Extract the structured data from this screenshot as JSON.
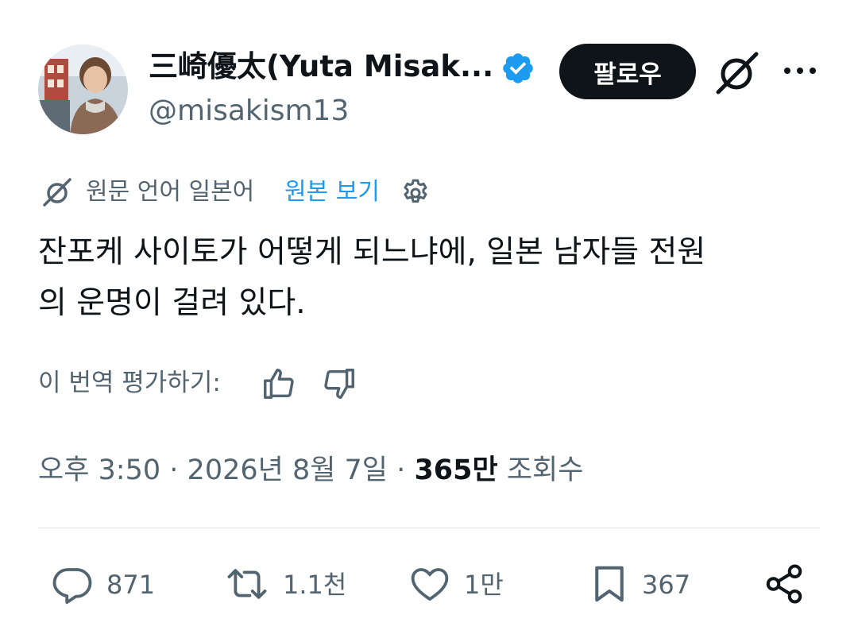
{
  "header": {
    "display_name": "三崎優太(Yuta Misak...",
    "handle": "@misakism13",
    "follow_label": "팔로우"
  },
  "translation": {
    "notice": "원문 언어 일본어",
    "view_original": "원본 보기"
  },
  "tweet": {
    "text_line1": "잔포케 사이토가 어떻게 되느냐에, 일본 남자들 전원",
    "text_line2": "의 운명이 걸려 있다."
  },
  "rate": {
    "label": "이 번역 평가하기:"
  },
  "meta": {
    "time": "오후 3:50",
    "date": "2026년 8월 7일",
    "views_count": "365만",
    "views_label": "조회수",
    "separator": "·"
  },
  "actions": {
    "replies": "871",
    "reposts": "1.1천",
    "likes": "1만",
    "bookmarks": "367"
  },
  "icons": {
    "verified": "verified-badge-icon",
    "grok": "grok-icon",
    "more": "more-icon",
    "translate": "grok-icon",
    "settings": "gear-icon",
    "thumb_up": "thumb-up-icon",
    "thumb_down": "thumb-down-icon",
    "reply": "reply-icon",
    "repost": "repost-icon",
    "like": "heart-icon",
    "bookmark": "bookmark-icon",
    "share": "share-icon"
  },
  "colors": {
    "text_primary": "#0f1419",
    "text_secondary": "#536471",
    "accent": "#1d9bf0",
    "button_bg": "#0f1419"
  }
}
